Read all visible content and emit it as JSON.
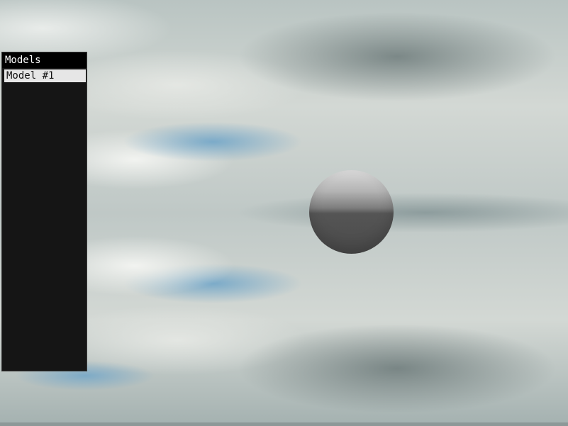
{
  "models_panel": {
    "title": "Models",
    "items": [
      {
        "label": "Model #1",
        "selected": true
      }
    ]
  },
  "colors": {
    "panel_background": "#151515",
    "title_background": "#000000",
    "selected_item_background": "#e6e6e6",
    "sphere": "#4a4a4a"
  }
}
